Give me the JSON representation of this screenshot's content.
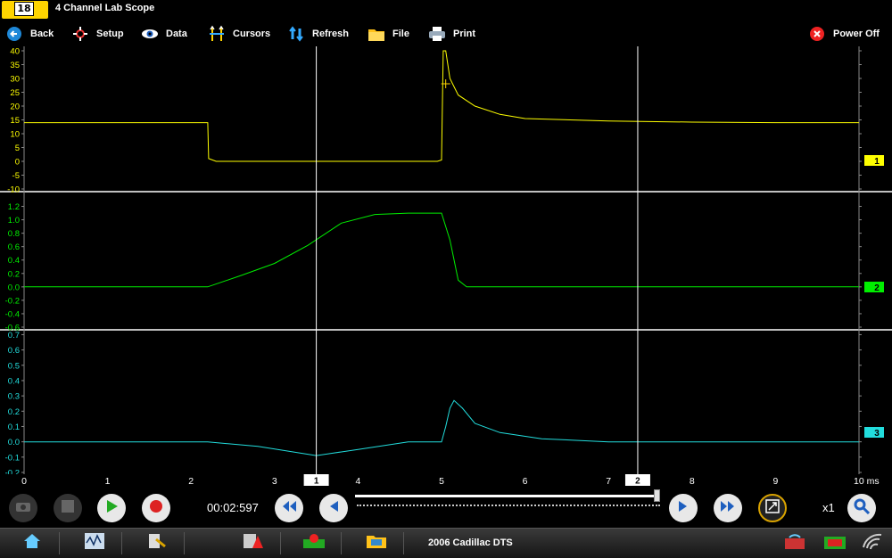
{
  "app": {
    "title": "4 Channel Lab Scope",
    "icon_label": "18"
  },
  "toolbar": {
    "back": "Back",
    "setup": "Setup",
    "data": "Data",
    "cursors": "Cursors",
    "refresh": "Refresh",
    "file": "File",
    "print": "Print",
    "power_off": "Power Off"
  },
  "colors": {
    "ch1": "#ffff00",
    "ch2": "#00ee00",
    "ch3": "#22dddd",
    "grid": "#ffffff"
  },
  "chart_data": [
    {
      "type": "line",
      "name": "channel-1",
      "channel_badge": "1",
      "ylim": [
        -10,
        40
      ],
      "y_ticks": [
        "40",
        "35",
        "30",
        "25",
        "20",
        "15",
        "10",
        "5",
        "0",
        "-5",
        "-10"
      ],
      "x": [
        0,
        2.2,
        2.21,
        2.3,
        4.95,
        5.0,
        5.02,
        5.05,
        5.1,
        5.2,
        5.4,
        5.7,
        6.0,
        7.0,
        8.0,
        9.0,
        10.0
      ],
      "y": [
        14,
        14,
        1,
        0,
        0,
        0.5,
        40,
        40,
        30,
        24,
        20,
        17,
        15.5,
        14.6,
        14.2,
        14,
        14
      ]
    },
    {
      "type": "line",
      "name": "channel-2",
      "channel_badge": "2",
      "ylim": [
        -0.6,
        1.3
      ],
      "y_ticks": [
        "1.2",
        "1.0",
        "0.8",
        "0.6",
        "0.4",
        "0.2",
        "0.0",
        "-0.2",
        "-0.4",
        "-0.6"
      ],
      "x": [
        0,
        2.2,
        2.6,
        3.0,
        3.4,
        3.8,
        4.2,
        4.6,
        5.0,
        5.1,
        5.2,
        5.3,
        6.0,
        8.0,
        10.0
      ],
      "y": [
        0,
        0,
        0.17,
        0.35,
        0.62,
        0.95,
        1.08,
        1.1,
        1.1,
        0.7,
        0.1,
        0.0,
        0.0,
        0.0,
        0.0
      ]
    },
    {
      "type": "line",
      "name": "channel-3",
      "channel_badge": "3",
      "ylim": [
        -0.2,
        0.72
      ],
      "y_ticks": [
        "0.7",
        "0.6",
        "0.5",
        "0.4",
        "0.3",
        "0.2",
        "0.1",
        "0.0",
        "-0.1",
        "-0.2"
      ],
      "x": [
        0,
        2.2,
        2.8,
        3.5,
        4.0,
        4.6,
        5.0,
        5.05,
        5.1,
        5.15,
        5.25,
        5.4,
        5.7,
        6.2,
        7.0,
        8.0,
        10.0
      ],
      "y": [
        0,
        0,
        -0.03,
        -0.09,
        -0.05,
        0.0,
        0.0,
        0.1,
        0.22,
        0.27,
        0.22,
        0.12,
        0.06,
        0.02,
        0.0,
        0.0,
        0.0
      ]
    }
  ],
  "time_axis": {
    "xlim": [
      0,
      10
    ],
    "ticks": [
      "0",
      "1",
      "2",
      "3",
      "4",
      "5",
      "6",
      "7",
      "8",
      "9",
      "10 ms"
    ],
    "cursor1_label": "1",
    "cursor2_label": "2",
    "cursor1_time": 3.5,
    "cursor2_time": 7.35
  },
  "playback": {
    "timestamp": "00:02:597",
    "zoom": "x1",
    "slider_position": 0.99
  },
  "taskbar": {
    "vehicle": "2006 Cadillac DTS"
  }
}
